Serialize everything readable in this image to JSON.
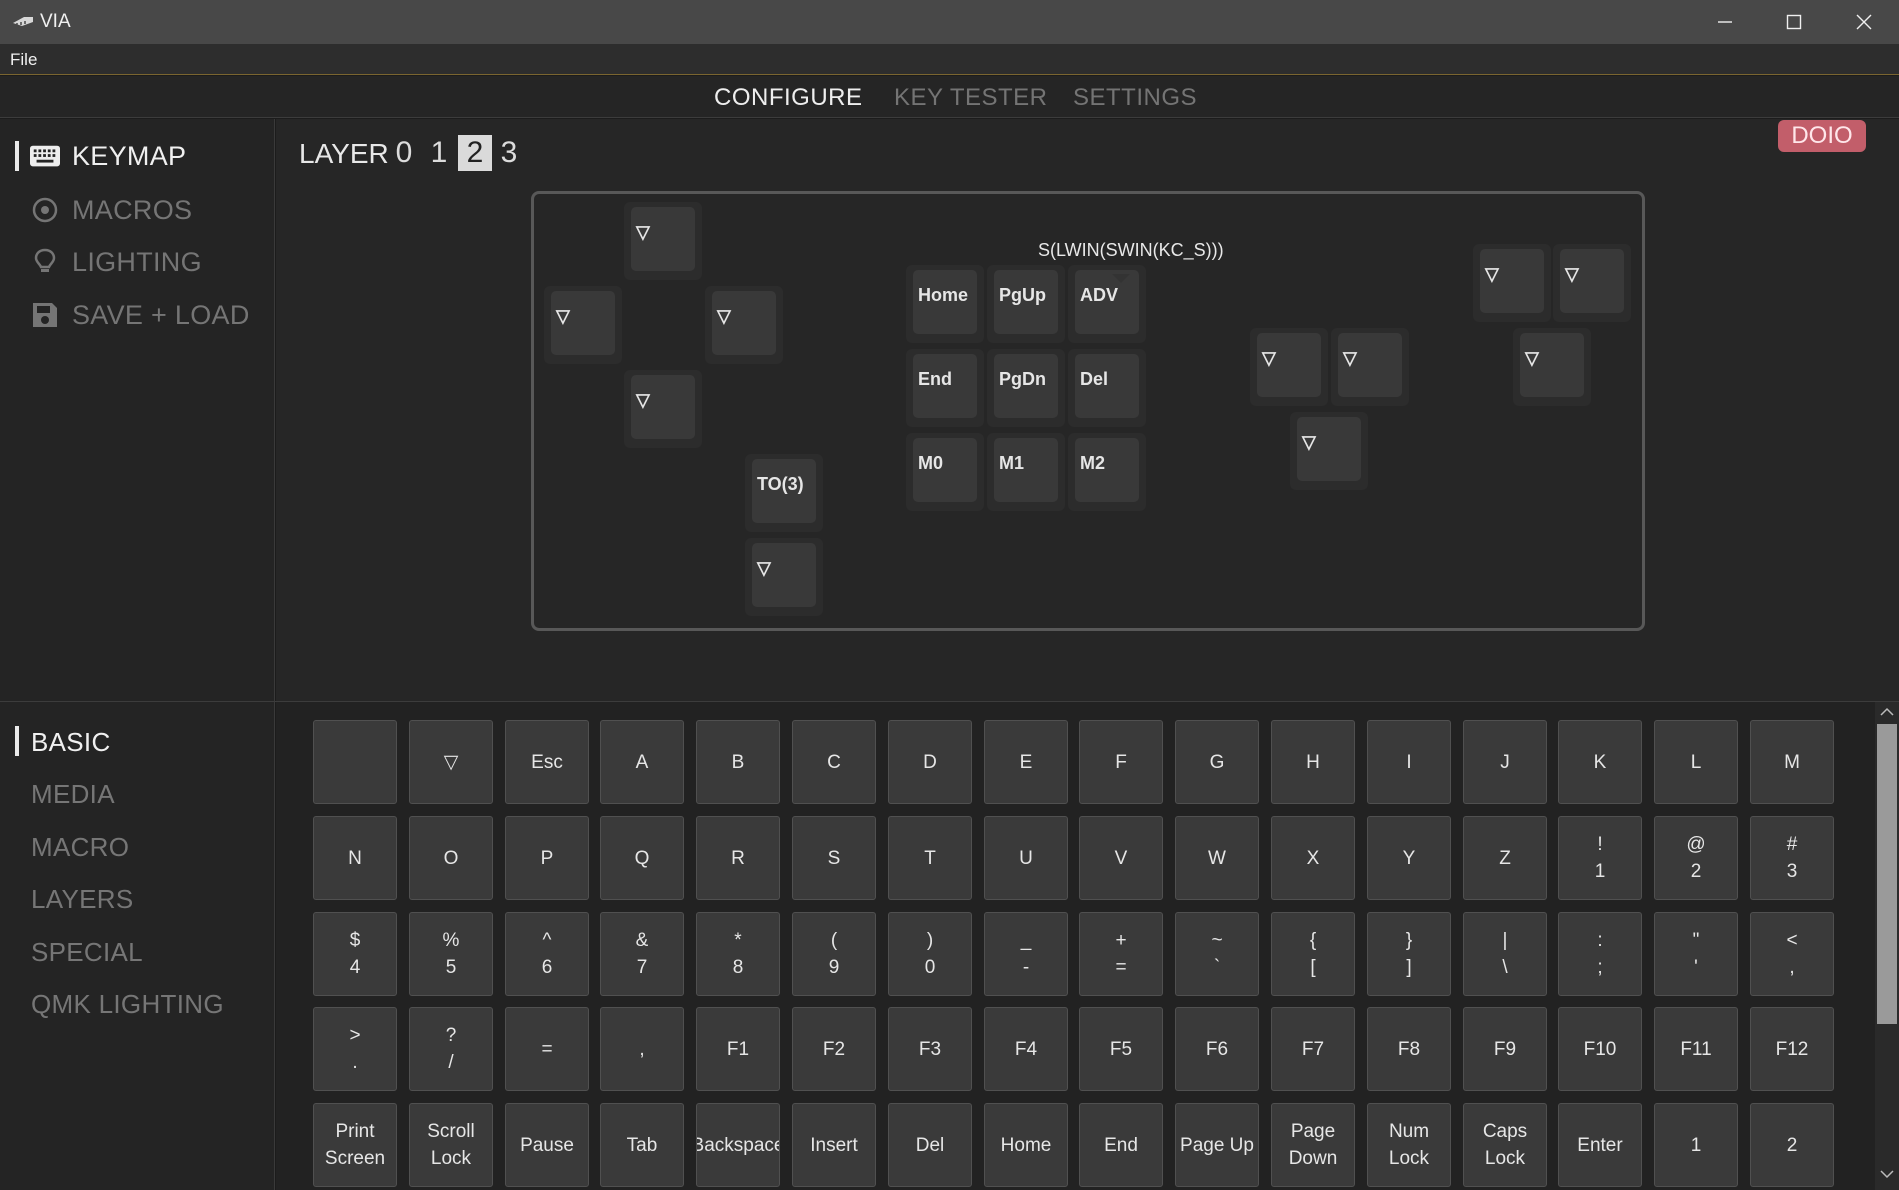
{
  "app": {
    "title": "VIA",
    "icon": "via-logo-icon"
  },
  "window_controls": [
    "minimize-icon",
    "maximize-icon",
    "close-icon"
  ],
  "menu": {
    "file": "File"
  },
  "top_tabs": [
    {
      "label": "CONFIGURE",
      "active": true
    },
    {
      "label": "KEY TESTER",
      "active": false
    },
    {
      "label": "SETTINGS",
      "active": false
    }
  ],
  "sidebar": {
    "items": [
      {
        "label": "KEYMAP",
        "icon": "keyboard-icon",
        "active": true
      },
      {
        "label": "MACROS",
        "icon": "macro-circle-icon",
        "active": false
      },
      {
        "label": "LIGHTING",
        "icon": "lightbulb-icon",
        "active": false
      },
      {
        "label": "SAVE + LOAD",
        "icon": "floppy-disk-icon",
        "active": false
      }
    ]
  },
  "layers": {
    "label": "LAYER",
    "numbers": [
      "0",
      "1",
      "2",
      "3"
    ],
    "selected": "2"
  },
  "brand": "DOIO",
  "colors": {
    "brand_badge": "#c25e6a",
    "background": "#1c1c1c",
    "key_cap": "#393939",
    "accent_line": "#7a6530"
  },
  "keyboard": {
    "tooltip": "S(LWIN(SWIN(KC_S)))",
    "keys": [
      "▽",
      "▽",
      "▽",
      "▽",
      "TO(3)",
      "▽",
      "Home",
      "PgUp",
      "ADV",
      "End",
      "PgDn",
      "Del",
      "M0",
      "M1",
      "M2",
      "▽",
      "▽",
      "▽",
      "▽",
      "▽",
      "▽"
    ]
  },
  "categories": [
    {
      "label": "BASIC",
      "active": true
    },
    {
      "label": "MEDIA",
      "active": false
    },
    {
      "label": "MACRO",
      "active": false
    },
    {
      "label": "LAYERS",
      "active": false
    },
    {
      "label": "SPECIAL",
      "active": false
    },
    {
      "label": "QMK LIGHTING",
      "active": false
    }
  ],
  "keycodes": [
    [
      "",
      "▽",
      "Esc",
      "A",
      "B",
      "C",
      "D",
      "E",
      "F",
      "G",
      "H",
      "I",
      "J",
      "K",
      "L",
      "M"
    ],
    [
      "N",
      "O",
      "P",
      "Q",
      "R",
      "S",
      "T",
      "U",
      "V",
      "W",
      "X",
      "Y",
      "Z",
      "!\n1",
      "@\n2",
      "#\n3"
    ],
    [
      "$\n4",
      "%\n5",
      "^\n6",
      "&\n7",
      "*\n8",
      "(\n9",
      ")\n0",
      "_\n-",
      "+\n=",
      "~\n`",
      "{\n[",
      "}\n]",
      "|\n\\",
      ":\n;",
      "\"\n'",
      "<\n,"
    ],
    [
      ">\n.",
      "?\n/",
      "=",
      ",",
      "F1",
      "F2",
      "F3",
      "F4",
      "F5",
      "F6",
      "F7",
      "F8",
      "F9",
      "F10",
      "F11",
      "F12"
    ],
    [
      "Print\nScreen",
      "Scroll\nLock",
      "Pause",
      "Tab",
      "Backspace",
      "Insert",
      "Del",
      "Home",
      "End",
      "Page Up",
      "Page\nDown",
      "Num\nLock",
      "Caps\nLock",
      "Enter",
      "1",
      "2"
    ]
  ]
}
